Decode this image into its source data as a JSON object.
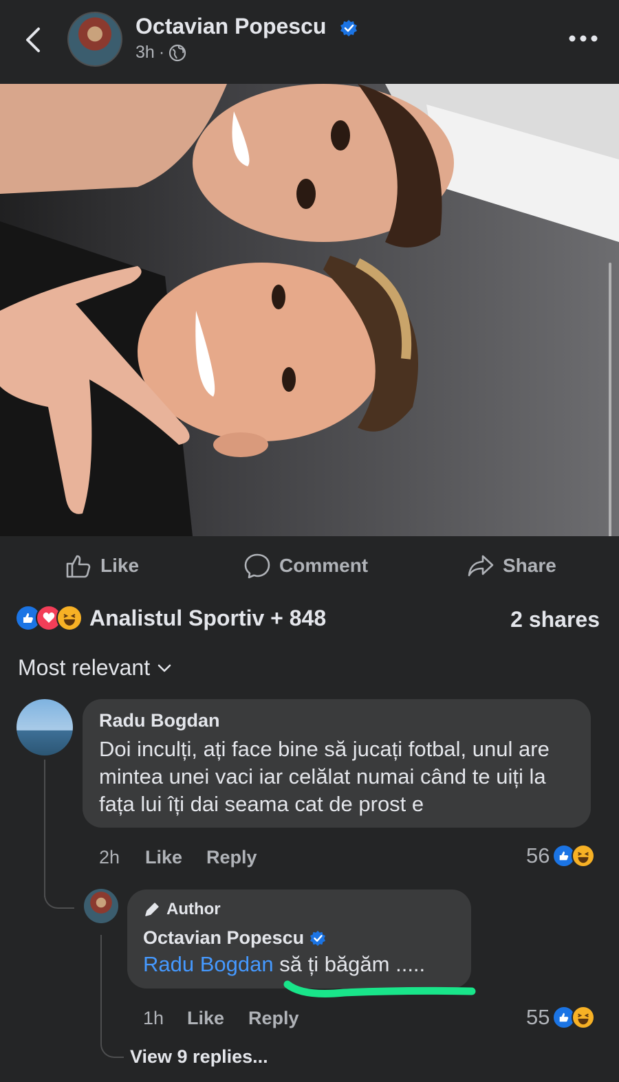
{
  "header": {
    "author_name": "Octavian Popescu",
    "time": "3h",
    "dot": "·"
  },
  "actions": {
    "like": "Like",
    "comment": "Comment",
    "share": "Share"
  },
  "stats": {
    "reactions_text": "Analistul Sportiv + 848",
    "shares": "2 shares"
  },
  "sort": {
    "label": "Most relevant"
  },
  "comment": {
    "author": "Radu Bogdan",
    "text": "Doi inculți, ați face bine să jucați fotbal, unul are mintea unei vaci iar celălat numai când te uiți la fața lui îți dai seama cat de prost e",
    "time": "2h",
    "like": "Like",
    "reply": "Reply",
    "reaction_count": "56"
  },
  "reply": {
    "badge": "Author",
    "author": "Octavian Popescu",
    "mention": "Radu Bogdan",
    "text": " să ți băgăm .....",
    "time": "1h",
    "like": "Like",
    "reply": "Reply",
    "reaction_count": "55"
  },
  "view_replies": "View 9 replies...",
  "colors": {
    "background": "#242526",
    "bubble": "#3a3b3c",
    "text": "#e4e6eb",
    "muted": "#b0b3b8",
    "accent": "#1b74e4",
    "mention": "#4599ff",
    "highlight": "#19e58a"
  },
  "icons": [
    "back-chevron-icon",
    "verified-badge-icon",
    "globe-icon",
    "more-icon",
    "like-icon",
    "comment-icon",
    "share-icon",
    "chevron-down-icon",
    "pencil-icon"
  ]
}
